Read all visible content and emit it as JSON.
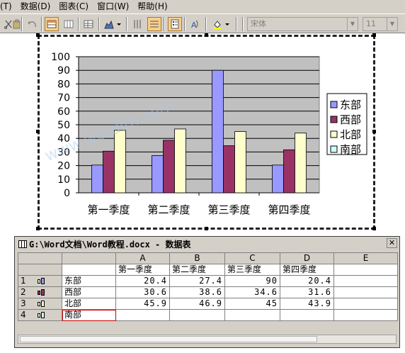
{
  "menu": [
    "(T)",
    "数据(D)",
    "图表(C)",
    "窗口(W)",
    "帮助(H)"
  ],
  "toolbar": {
    "font_name": "宋体",
    "font_size": "11"
  },
  "chart_data": {
    "type": "bar",
    "categories": [
      "第一季度",
      "第二季度",
      "第三季度",
      "第四季度"
    ],
    "series": [
      {
        "name": "东部",
        "values": [
          20.4,
          27.4,
          90,
          20.4
        ],
        "color": "#9999ff"
      },
      {
        "name": "西部",
        "values": [
          30.6,
          38.6,
          34.6,
          31.6
        ],
        "color": "#993366"
      },
      {
        "name": "北部",
        "values": [
          45.9,
          46.9,
          45,
          43.9
        ],
        "color": "#ffffcc"
      },
      {
        "name": "南部",
        "values": [
          null,
          null,
          null,
          null
        ],
        "color": "#ccffff"
      }
    ],
    "ylim": [
      0,
      100
    ],
    "yticks": [
      "0",
      "10",
      "20",
      "30",
      "40",
      "50",
      "60",
      "70",
      "80",
      "90",
      "100"
    ],
    "plot_bg": "#c0c0c0",
    "grid": true,
    "legend": "right"
  },
  "datasheet": {
    "title": "G:\\Word文档\\Word教程.docx - 数据表",
    "columns": [
      "A",
      "B",
      "C",
      "D",
      "E"
    ],
    "headers": [
      "第一季度",
      "第二季度",
      "第三季度",
      "第四季度",
      ""
    ],
    "rows": [
      {
        "num": "1",
        "label": "东部",
        "values": [
          "20.4",
          "27.4",
          "90",
          "20.4",
          ""
        ]
      },
      {
        "num": "2",
        "label": "西部",
        "values": [
          "30.6",
          "38.6",
          "34.6",
          "31.6",
          ""
        ]
      },
      {
        "num": "3",
        "label": "北部",
        "values": [
          "45.9",
          "46.9",
          "45",
          "43.9",
          ""
        ]
      },
      {
        "num": "4",
        "label": "南部",
        "values": [
          "",
          "",
          "",
          "",
          ""
        ]
      }
    ]
  },
  "watermark": "www.wordlm.com"
}
